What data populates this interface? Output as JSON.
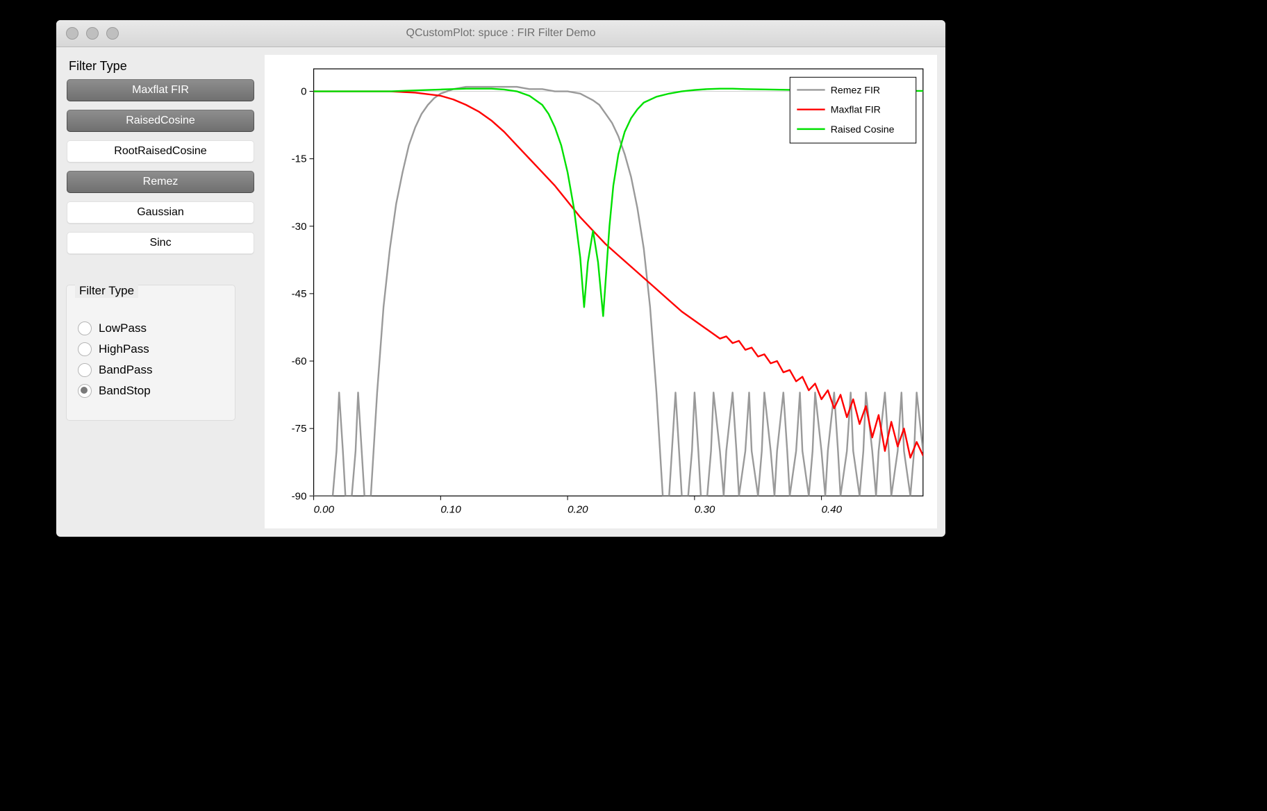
{
  "window": {
    "title": "QCustomPlot: spuce : FIR Filter Demo"
  },
  "sidebar": {
    "label": "Filter Type",
    "buttons": [
      {
        "label": "Maxflat FIR",
        "active": true
      },
      {
        "label": "RaisedCosine",
        "active": true
      },
      {
        "label": "RootRaisedCosine",
        "active": false
      },
      {
        "label": "Remez",
        "active": true
      },
      {
        "label": "Gaussian",
        "active": false
      },
      {
        "label": "Sinc",
        "active": false
      }
    ],
    "group": {
      "title": "Filter Type",
      "options": [
        {
          "label": "LowPass",
          "selected": false
        },
        {
          "label": "HighPass",
          "selected": false
        },
        {
          "label": "BandPass",
          "selected": false
        },
        {
          "label": "BandStop",
          "selected": true
        }
      ]
    }
  },
  "chart_data": {
    "type": "line",
    "xlabel": "",
    "ylabel": "",
    "xlim": [
      0.0,
      0.48
    ],
    "ylim": [
      -90,
      5
    ],
    "xticks": [
      0.0,
      0.1,
      0.2,
      0.3,
      0.4
    ],
    "yticks": [
      0,
      -15,
      -30,
      -45,
      -60,
      -75,
      -90
    ],
    "legend": {
      "position": "top-right",
      "items": [
        "Remez FIR",
        "Maxflat FIR",
        "Raised Cosine"
      ]
    },
    "series": [
      {
        "name": "Remez FIR",
        "color": "#9a9a9a",
        "x": [
          0.0,
          0.005,
          0.01,
          0.015,
          0.018,
          0.02,
          0.023,
          0.025,
          0.03,
          0.033,
          0.035,
          0.04,
          0.045,
          0.05,
          0.055,
          0.06,
          0.065,
          0.07,
          0.075,
          0.08,
          0.085,
          0.09,
          0.095,
          0.1,
          0.11,
          0.12,
          0.13,
          0.14,
          0.15,
          0.16,
          0.17,
          0.18,
          0.19,
          0.2,
          0.21,
          0.22,
          0.225,
          0.23,
          0.235,
          0.24,
          0.245,
          0.25,
          0.255,
          0.26,
          0.265,
          0.27,
          0.275,
          0.28,
          0.285,
          0.29,
          0.295,
          0.298,
          0.3,
          0.303,
          0.305,
          0.31,
          0.313,
          0.315,
          0.32,
          0.323,
          0.325,
          0.33,
          0.333,
          0.335,
          0.34,
          0.343,
          0.345,
          0.35,
          0.353,
          0.355,
          0.36,
          0.363,
          0.365,
          0.37,
          0.373,
          0.375,
          0.38,
          0.383,
          0.385,
          0.39,
          0.393,
          0.395,
          0.4,
          0.403,
          0.405,
          0.41,
          0.413,
          0.415,
          0.42,
          0.423,
          0.425,
          0.43,
          0.433,
          0.435,
          0.44,
          0.443,
          0.445,
          0.45,
          0.453,
          0.455,
          0.46,
          0.463,
          0.465,
          0.47,
          0.473,
          0.475,
          0.48
        ],
        "y": [
          -90,
          -90,
          -90,
          -90,
          -80,
          -67,
          -80,
          -90,
          -90,
          -80,
          -67,
          -90,
          -90,
          -67,
          -48,
          -35,
          -25,
          -18,
          -12,
          -8,
          -5,
          -3,
          -1.5,
          -0.5,
          0.5,
          1,
          1,
          1,
          1,
          1,
          0.5,
          0.5,
          0,
          0,
          -0.5,
          -2,
          -3,
          -5,
          -7,
          -10,
          -14,
          -19,
          -26,
          -35,
          -48,
          -67,
          -90,
          -90,
          -67,
          -90,
          -90,
          -80,
          -67,
          -80,
          -90,
          -90,
          -80,
          -67,
          -80,
          -90,
          -80,
          -67,
          -80,
          -90,
          -80,
          -67,
          -80,
          -90,
          -80,
          -67,
          -80,
          -90,
          -80,
          -67,
          -80,
          -90,
          -80,
          -67,
          -80,
          -90,
          -80,
          -67,
          -80,
          -90,
          -80,
          -67,
          -80,
          -90,
          -80,
          -67,
          -80,
          -90,
          -80,
          -67,
          -80,
          -90,
          -80,
          -67,
          -80,
          -90,
          -80,
          -67,
          -80,
          -90,
          -80,
          -67,
          -80
        ]
      },
      {
        "name": "Maxflat FIR",
        "color": "#ff0000",
        "x": [
          0.0,
          0.02,
          0.04,
          0.06,
          0.08,
          0.1,
          0.11,
          0.12,
          0.13,
          0.14,
          0.15,
          0.16,
          0.17,
          0.18,
          0.19,
          0.2,
          0.21,
          0.22,
          0.23,
          0.24,
          0.25,
          0.26,
          0.27,
          0.28,
          0.29,
          0.3,
          0.31,
          0.32,
          0.325,
          0.33,
          0.335,
          0.34,
          0.345,
          0.35,
          0.355,
          0.36,
          0.365,
          0.37,
          0.375,
          0.38,
          0.385,
          0.39,
          0.395,
          0.4,
          0.405,
          0.41,
          0.415,
          0.42,
          0.425,
          0.43,
          0.435,
          0.44,
          0.445,
          0.45,
          0.455,
          0.46,
          0.465,
          0.47,
          0.475,
          0.48
        ],
        "y": [
          0,
          0,
          0,
          0,
          -0.3,
          -1,
          -1.8,
          -3,
          -4.5,
          -6.5,
          -9,
          -12,
          -15,
          -18,
          -21,
          -24.5,
          -28,
          -31,
          -34,
          -36.5,
          -39,
          -41.5,
          -44,
          -46.5,
          -49,
          -51,
          -53,
          -55,
          -54.5,
          -56,
          -55.5,
          -57.5,
          -57,
          -59,
          -58.5,
          -60.5,
          -60,
          -62.5,
          -62,
          -64.5,
          -63.5,
          -66.5,
          -65,
          -68.5,
          -66.5,
          -70.5,
          -67.5,
          -72.5,
          -68.5,
          -74,
          -70,
          -77,
          -72,
          -80,
          -73.5,
          -79,
          -75,
          -81.5,
          -78,
          -81
        ]
      },
      {
        "name": "Raised Cosine",
        "color": "#00e000",
        "x": [
          0.0,
          0.02,
          0.04,
          0.06,
          0.08,
          0.1,
          0.12,
          0.14,
          0.15,
          0.16,
          0.17,
          0.18,
          0.185,
          0.19,
          0.195,
          0.2,
          0.205,
          0.21,
          0.213,
          0.216,
          0.22,
          0.224,
          0.228,
          0.23,
          0.233,
          0.236,
          0.24,
          0.245,
          0.25,
          0.255,
          0.26,
          0.27,
          0.28,
          0.29,
          0.3,
          0.31,
          0.32,
          0.33,
          0.34,
          0.36,
          0.38,
          0.4,
          0.42,
          0.44,
          0.46,
          0.48
        ],
        "y": [
          0,
          0,
          0,
          0,
          0.2,
          0.4,
          0.6,
          0.6,
          0.4,
          0,
          -1,
          -3,
          -5,
          -8,
          -12,
          -18,
          -26,
          -37,
          -48,
          -38,
          -31,
          -38,
          -50,
          -42,
          -30,
          -21,
          -14,
          -9,
          -6,
          -4,
          -2.5,
          -1.2,
          -0.5,
          0,
          0.3,
          0.5,
          0.6,
          0.6,
          0.5,
          0.4,
          0.3,
          0.2,
          0.2,
          0.1,
          0.1,
          0.1
        ]
      }
    ]
  }
}
